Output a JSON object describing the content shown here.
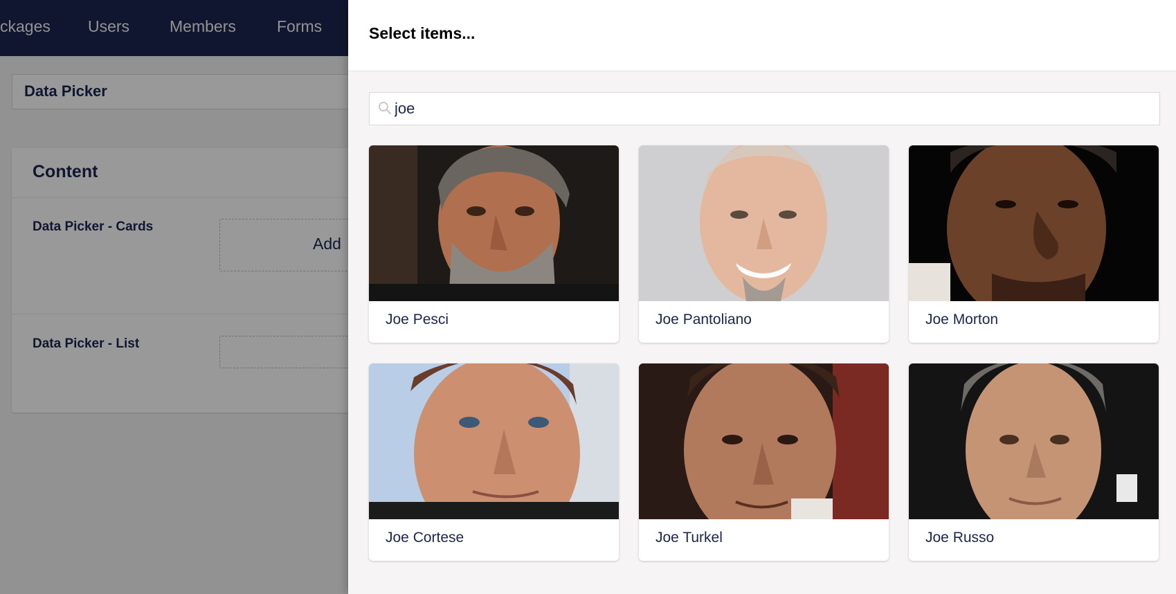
{
  "nav": {
    "items": [
      {
        "label": "ckages"
      },
      {
        "label": "Users"
      },
      {
        "label": "Members"
      },
      {
        "label": "Forms"
      }
    ]
  },
  "document": {
    "name": "Data Picker",
    "panel_title": "Content",
    "properties": [
      {
        "label": "Data Picker - Cards",
        "add_label": "Add"
      },
      {
        "label": "Data Picker - List"
      }
    ]
  },
  "dialog": {
    "title": "Select items...",
    "search": {
      "value": "joe"
    },
    "items": [
      {
        "name": "Joe Pesci"
      },
      {
        "name": "Joe Pantoliano"
      },
      {
        "name": "Joe Morton"
      },
      {
        "name": "Joe Cortese"
      },
      {
        "name": "Joe Turkel"
      },
      {
        "name": "Joe Russo"
      }
    ]
  },
  "colors": {
    "nav_bg": "#1b264f",
    "text_primary": "#1b264f",
    "dialog_bg": "#f6f4f4"
  }
}
